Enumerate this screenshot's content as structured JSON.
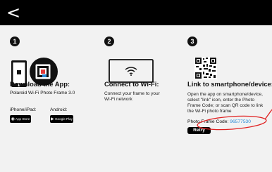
{
  "topbar": {
    "back_glyph": "<"
  },
  "steps": [
    {
      "number": "1",
      "title": "Download the App:",
      "subtitle": "Polaroid Wi-Fi Photo Frame 3.0",
      "iphone_label": "iPhone/iPad:",
      "android_label": "Android:",
      "app_store_badge": "App Store",
      "google_play_badge": "Google Play"
    },
    {
      "number": "2",
      "title": "Connect to Wi-Fi:",
      "desc_line1": "Connect your frame to your",
      "desc_line2": "Wi-Fi network"
    },
    {
      "number": "3",
      "title": "Link to smartphone/device:",
      "desc_line1": "Open the app on smartphone/device,",
      "desc_line2": "select \"link\" icon, enter the Photo",
      "desc_line3": "Frame Code; or scan QR code to link",
      "desc_line4": "the Wi-Fi photo frame",
      "frame_code_label": "Photo Frame Code:",
      "frame_code_value": "96577530",
      "retry_label": "Retry"
    }
  ],
  "colors": {
    "background": "#f2f2f2",
    "topbar": "#000000",
    "code_blue": "#2a8ad6",
    "annotation_red": "#e02020"
  },
  "icons": {
    "step1": "phone-and-frame-icon",
    "step2": "wifi-frame-icon",
    "step3": "qr-code-icon"
  }
}
